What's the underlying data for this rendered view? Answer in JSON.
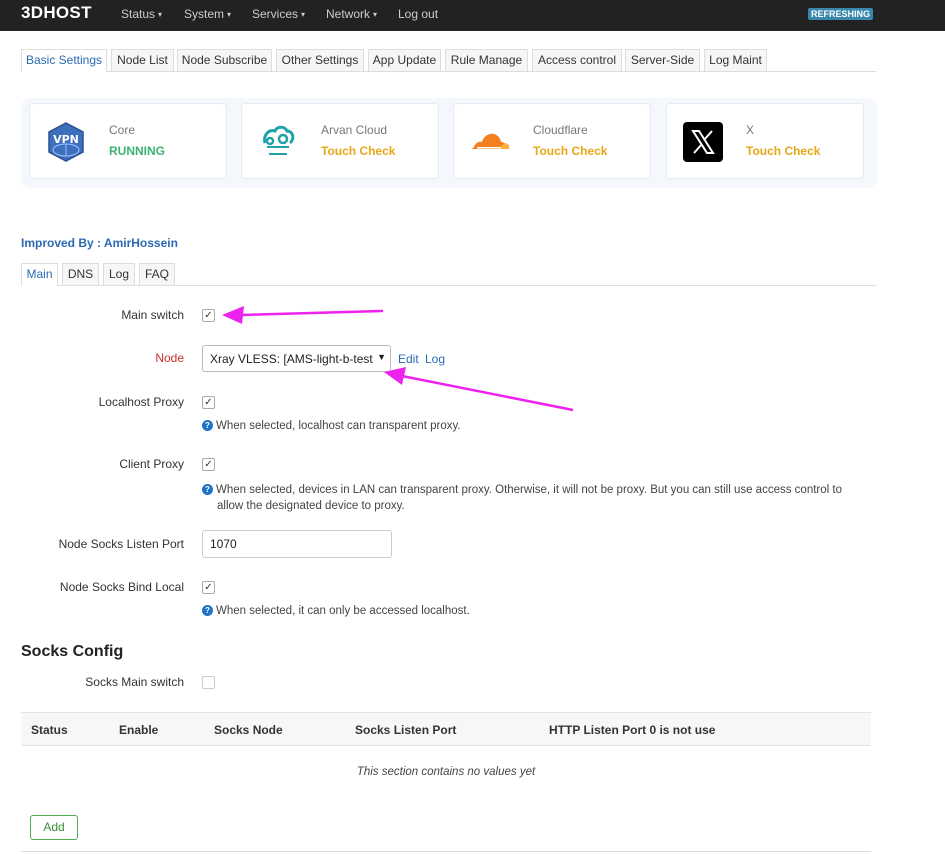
{
  "app": {
    "brand": "3DHOST",
    "badge": "REFRESHING",
    "menu": [
      {
        "label": "Status",
        "caret": "▾"
      },
      {
        "label": "System",
        "caret": "▾"
      },
      {
        "label": "Services",
        "caret": "▾"
      },
      {
        "label": "Network",
        "caret": "▾"
      },
      {
        "label": "Log out",
        "caret": ""
      }
    ]
  },
  "tabs": [
    "Basic Settings",
    "Node List",
    "Node Subscribe",
    "Other Settings",
    "App Update",
    "Rule Manage",
    "Access control",
    "Server-Side",
    "Log Maint"
  ],
  "active_tab": "Basic Settings",
  "cards": [
    {
      "title": "Core",
      "status": "RUNNING",
      "status_color": "#3cb371",
      "icon": "vpn-icon"
    },
    {
      "title": "Arvan Cloud",
      "status": "Touch Check",
      "status_color": "#e6a817",
      "icon": "arvan-cloud-logo"
    },
    {
      "title": "Cloudflare",
      "status": "Touch Check",
      "status_color": "#e6a817",
      "icon": "cloudflare-logo"
    },
    {
      "title": "X",
      "status": "Touch Check",
      "status_color": "#e6a817",
      "icon": "x-logo"
    }
  ],
  "improved_by": "Improved By : AmirHossein",
  "subtabs": [
    "Main",
    "DNS",
    "Log",
    "FAQ"
  ],
  "active_subtab": "Main",
  "form": {
    "main_switch": {
      "label": "Main switch",
      "checked": true,
      "mark": "✓"
    },
    "node": {
      "label": "Node",
      "value": "Xray VLESS: [AMS-light-b-test",
      "edit": "Edit",
      "log": "Log"
    },
    "localhost_proxy": {
      "label": "Localhost Proxy",
      "checked": true,
      "mark": "✓",
      "help": "When selected, localhost can transparent proxy."
    },
    "client_proxy": {
      "label": "Client Proxy",
      "checked": true,
      "mark": "✓",
      "help_line1": "When selected, devices in LAN can transparent proxy. Otherwise, it will not be proxy. But you can still use access control to",
      "help_line2": "allow the designated device to proxy."
    },
    "socks_port": {
      "label": "Node Socks Listen Port",
      "value": "1070"
    },
    "socks_bind_local": {
      "label": "Node Socks Bind Local",
      "checked": true,
      "mark": "✓",
      "help": "When selected, it can only be accessed localhost."
    }
  },
  "socks": {
    "title": "Socks Config",
    "main_switch_label": "Socks Main switch",
    "main_switch_checked": false,
    "columns": [
      "Status",
      "Enable",
      "Socks Node",
      "Socks Listen Port",
      "HTTP Listen Port 0 is not use"
    ],
    "empty_text": "This section contains no values yet",
    "add_label": "Add"
  },
  "colors": {
    "accent": "#2a6ab3",
    "annotation_arrow": "#ee22ee",
    "topbar": "#222222"
  }
}
